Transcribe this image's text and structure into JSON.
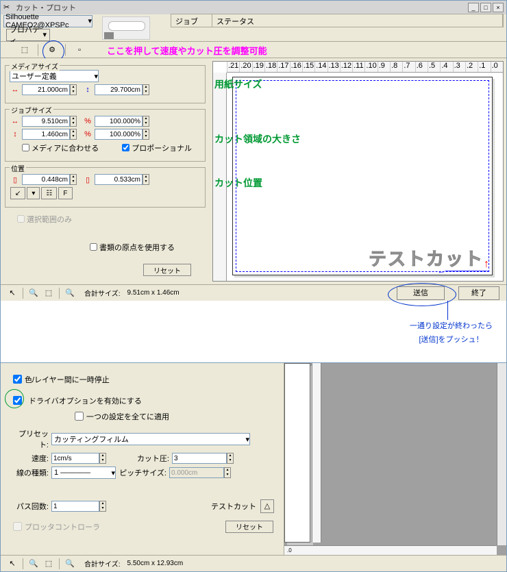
{
  "window1": {
    "title": "カット・プロット",
    "printer": "Silhouette CAMEO2@XPSPc",
    "properties_btn": "プロパティ...",
    "job_header": {
      "col1": "ジョブ",
      "col2": "ステータス"
    },
    "annotation_pink": "ここを押して速度やカット圧を調整可能",
    "media_size": {
      "title": "メディアサイズ",
      "preset": "ユーザー定義",
      "width": "21.000cm",
      "height": "29.700cm",
      "note": "用紙サイズ"
    },
    "job_size": {
      "title": "ジョブサイズ",
      "width": "9.510cm",
      "height": "1.460cm",
      "pct_w": "100.000%",
      "pct_h": "100.000%",
      "fit_media": "メディアに合わせる",
      "proportional": "プロポーショナル",
      "note": "カット領域の大きさ"
    },
    "position": {
      "title": "位置",
      "x": "0.448cm",
      "y": "0.533cm",
      "btns": [
        "↙",
        "▾",
        "☷",
        "F"
      ],
      "note": "カット位置"
    },
    "selection_only": "選択範囲のみ",
    "use_doc_origin": "書類の原点を使用する",
    "reset": "リセット",
    "page_text": "テストカット",
    "ruler_vals": [
      "21",
      "20",
      "19",
      "18",
      "17",
      "16",
      "15",
      "14",
      "13",
      "12",
      "11",
      "10",
      "9",
      "8",
      "7",
      "6",
      "5",
      "4",
      "3",
      "2",
      "1",
      "0"
    ],
    "statusbar": {
      "label": "合計サイズ:",
      "value": "9.51cm x 1.46cm"
    },
    "send": "送信",
    "exit": "終了",
    "send_annot1": "一通り設定が終わったら",
    "send_annot2": "[送信]をプッシュ！"
  },
  "window2": {
    "pause_layers": "色/レイヤー間に一時停止",
    "enable_driver": "ドライバオプションを有効にする",
    "apply_all": "一つの設定を全てに適用",
    "preset_lbl": "プリセット:",
    "preset_val": "カッティングフィルム",
    "speed_lbl": "速度:",
    "speed_val": "1cm/s",
    "cut_pressure_lbl": "カット圧:",
    "cut_pressure_val": "3",
    "line_type_lbl": "線の種類:",
    "line_type_val": "1 ————",
    "pitch_lbl": "ピッチサイズ:",
    "pitch_val": "0.000cm",
    "pass_lbl": "パス回数:",
    "pass_val": "1",
    "testcut_lbl": "テストカット",
    "plotter_ctrl": "プロッタコントローラ",
    "reset": "リセット",
    "statusbar": {
      "label": "合計サイズ:",
      "value": "5.50cm x 12.93cm"
    }
  }
}
